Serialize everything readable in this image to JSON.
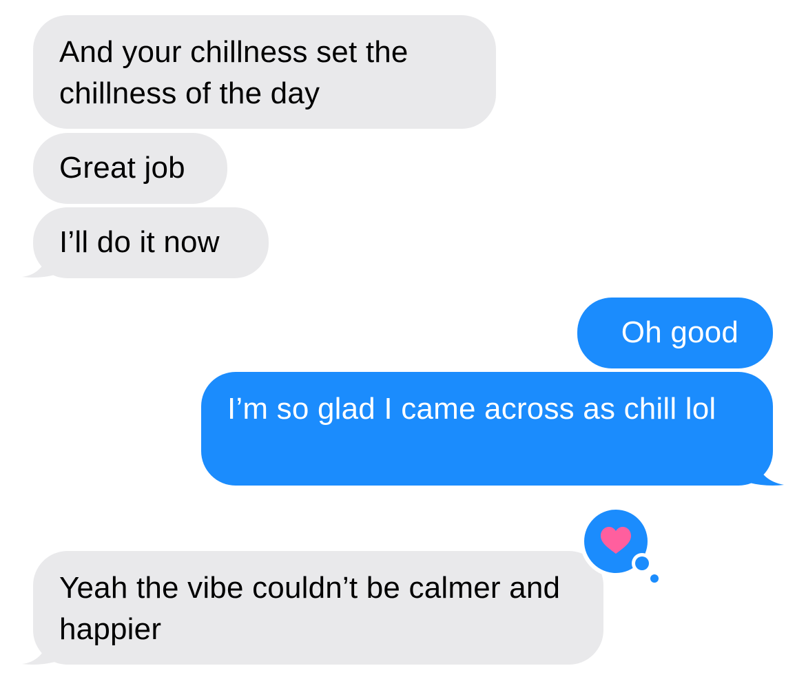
{
  "conversation": {
    "messages": [
      {
        "direction": "incoming",
        "text": "And your chillness set the chillness of the day"
      },
      {
        "direction": "incoming",
        "text": "Great job"
      },
      {
        "direction": "incoming",
        "text": "I’ll do it now"
      },
      {
        "direction": "outgoing",
        "text": "Oh good"
      },
      {
        "direction": "outgoing",
        "text": "I’m so glad I came across as chill lol"
      },
      {
        "direction": "incoming",
        "text": "Yeah the vibe couldn’t be calmer and happier",
        "reaction": "heart-icon"
      }
    ]
  },
  "colors": {
    "incoming_bubble": "#e9e9eb",
    "outgoing_bubble": "#1b8cfd",
    "reaction_badge": "#1b8cfd",
    "heart": "#ff5f9e"
  }
}
